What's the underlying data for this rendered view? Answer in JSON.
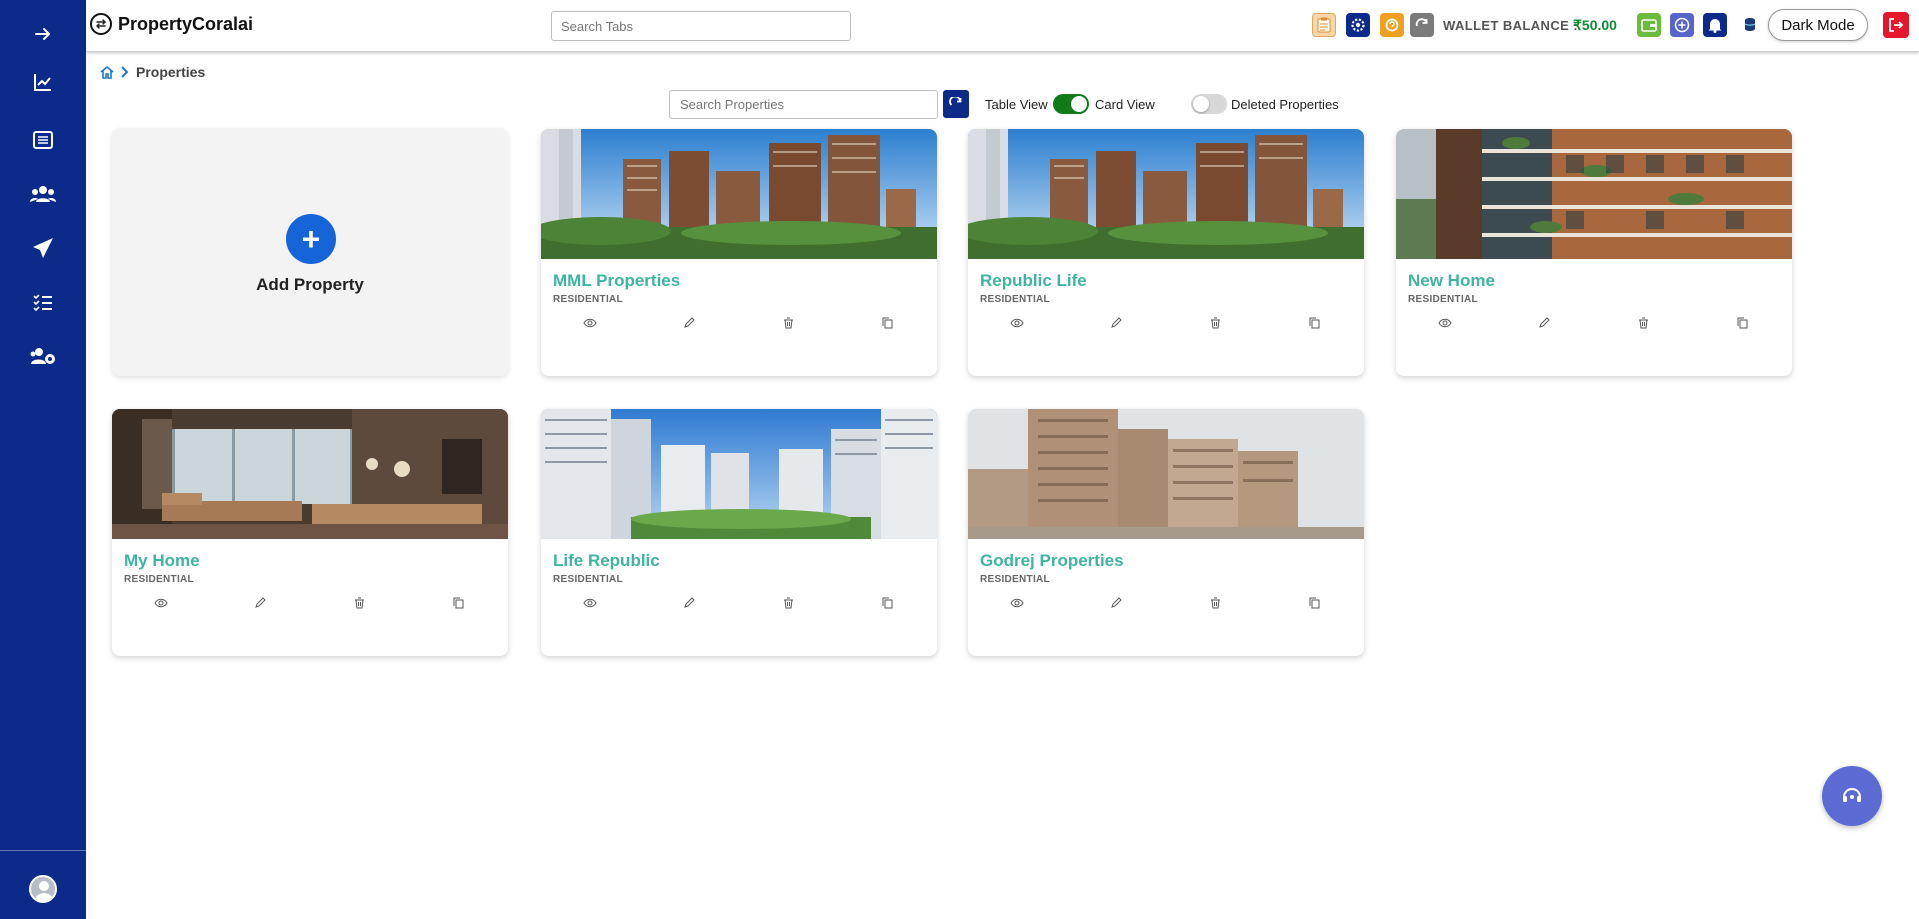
{
  "header": {
    "brand": "PropertyCoralai",
    "tab_search_placeholder": "Search Tabs",
    "wallet_label": "WALLET BALANCE :",
    "wallet_amount": "₹50.00",
    "dark_mode_label": "Dark Mode",
    "icons": [
      "clipboard-icon",
      "settings-icon",
      "support-icon",
      "refresh-icon",
      "wallet-icon",
      "add-circle-icon",
      "bell-icon",
      "database-icon",
      "logout-icon"
    ]
  },
  "sidebar": {
    "items": [
      "expand-icon",
      "analytics-icon",
      "list-icon",
      "users-icon",
      "send-icon",
      "checklist-icon",
      "team-settings-icon"
    ]
  },
  "breadcrumb": {
    "current": "Properties"
  },
  "toolbar": {
    "search_placeholder": "Search Properties",
    "table_view_label": "Table View",
    "card_view_label": "Card View",
    "view_toggle_on": true,
    "deleted_label": "Deleted Properties",
    "deleted_toggle_on": false
  },
  "add_card": {
    "label": "Add Property"
  },
  "properties": [
    {
      "name": "MML Properties",
      "type": "RESIDENTIAL"
    },
    {
      "name": "Republic Life",
      "type": "RESIDENTIAL"
    },
    {
      "name": "New Home",
      "type": "RESIDENTIAL"
    },
    {
      "name": "My Home",
      "type": "RESIDENTIAL"
    },
    {
      "name": "Life Republic",
      "type": "RESIDENTIAL"
    },
    {
      "name": "Godrej Properties",
      "type": "RESIDENTIAL"
    }
  ],
  "colors": {
    "sidebar": "#0b2a8a",
    "accent_title": "#3fb4a0",
    "wallet_amount": "#0c8f2f",
    "toggle_on": "#137a1a",
    "add_button": "#1565d8"
  }
}
